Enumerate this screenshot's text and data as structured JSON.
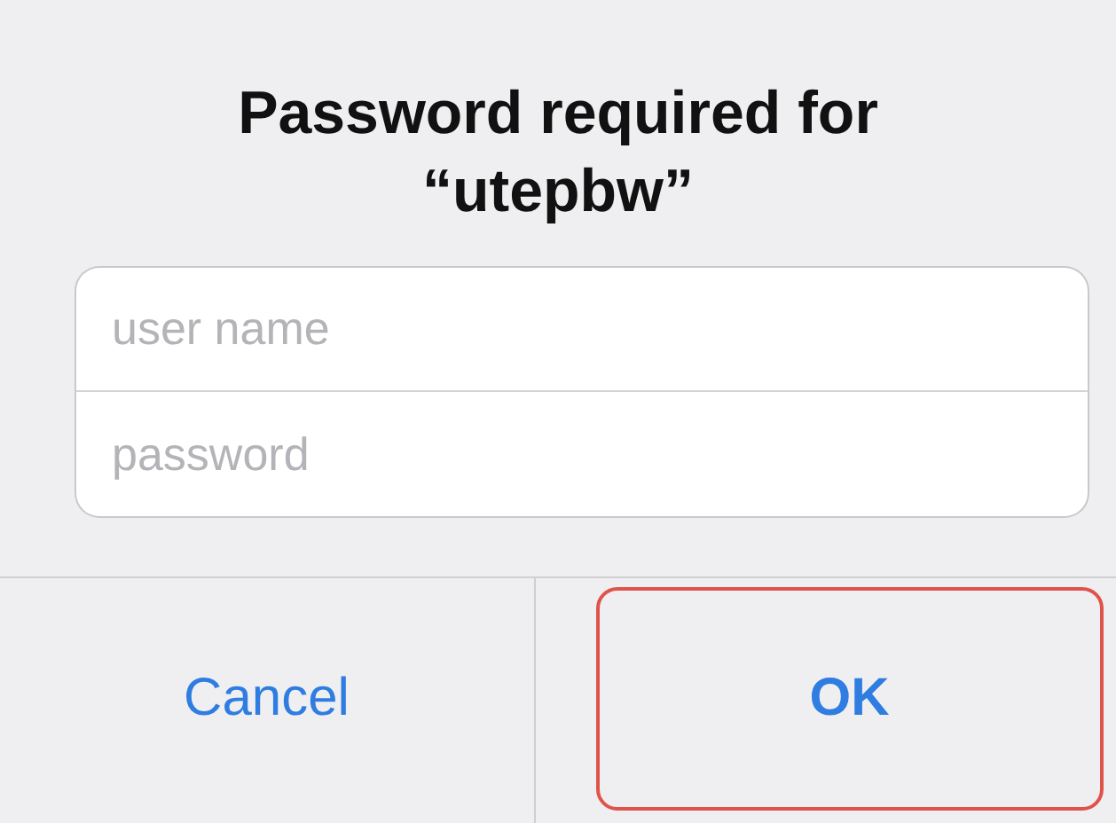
{
  "alert": {
    "title": "Password required for “utepbw”"
  },
  "fields": [
    {
      "placeholder": "user name"
    },
    {
      "placeholder": "password"
    }
  ],
  "buttons": [
    {
      "label": "Cancel",
      "kind": "cancel",
      "highlighted": false
    },
    {
      "label": "OK",
      "kind": "default",
      "highlighted": true
    }
  ]
}
